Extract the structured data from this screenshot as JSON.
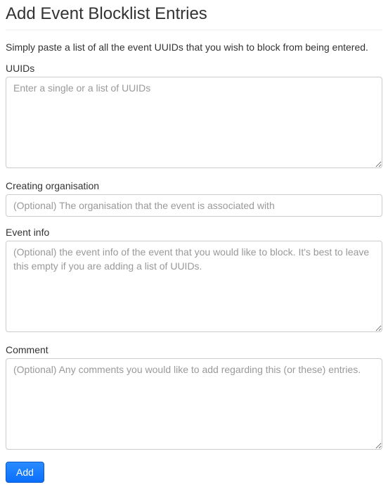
{
  "page": {
    "title": "Add Event Blocklist Entries",
    "description": "Simply paste a list of all the event UUIDs that you wish to block from being entered."
  },
  "fields": {
    "uuids": {
      "label": "UUIDs",
      "placeholder": "Enter a single or a list of UUIDs",
      "value": ""
    },
    "org": {
      "label": "Creating organisation",
      "placeholder": "(Optional) The organisation that the event is associated with",
      "value": ""
    },
    "info": {
      "label": "Event info",
      "placeholder": "(Optional) the event info of the event that you would like to block. It's best to leave this empty if you are adding a list of UUIDs.",
      "value": ""
    },
    "comment": {
      "label": "Comment",
      "placeholder": "(Optional) Any comments you would like to add regarding this (or these) entries.",
      "value": ""
    }
  },
  "actions": {
    "submit_label": "Add"
  }
}
